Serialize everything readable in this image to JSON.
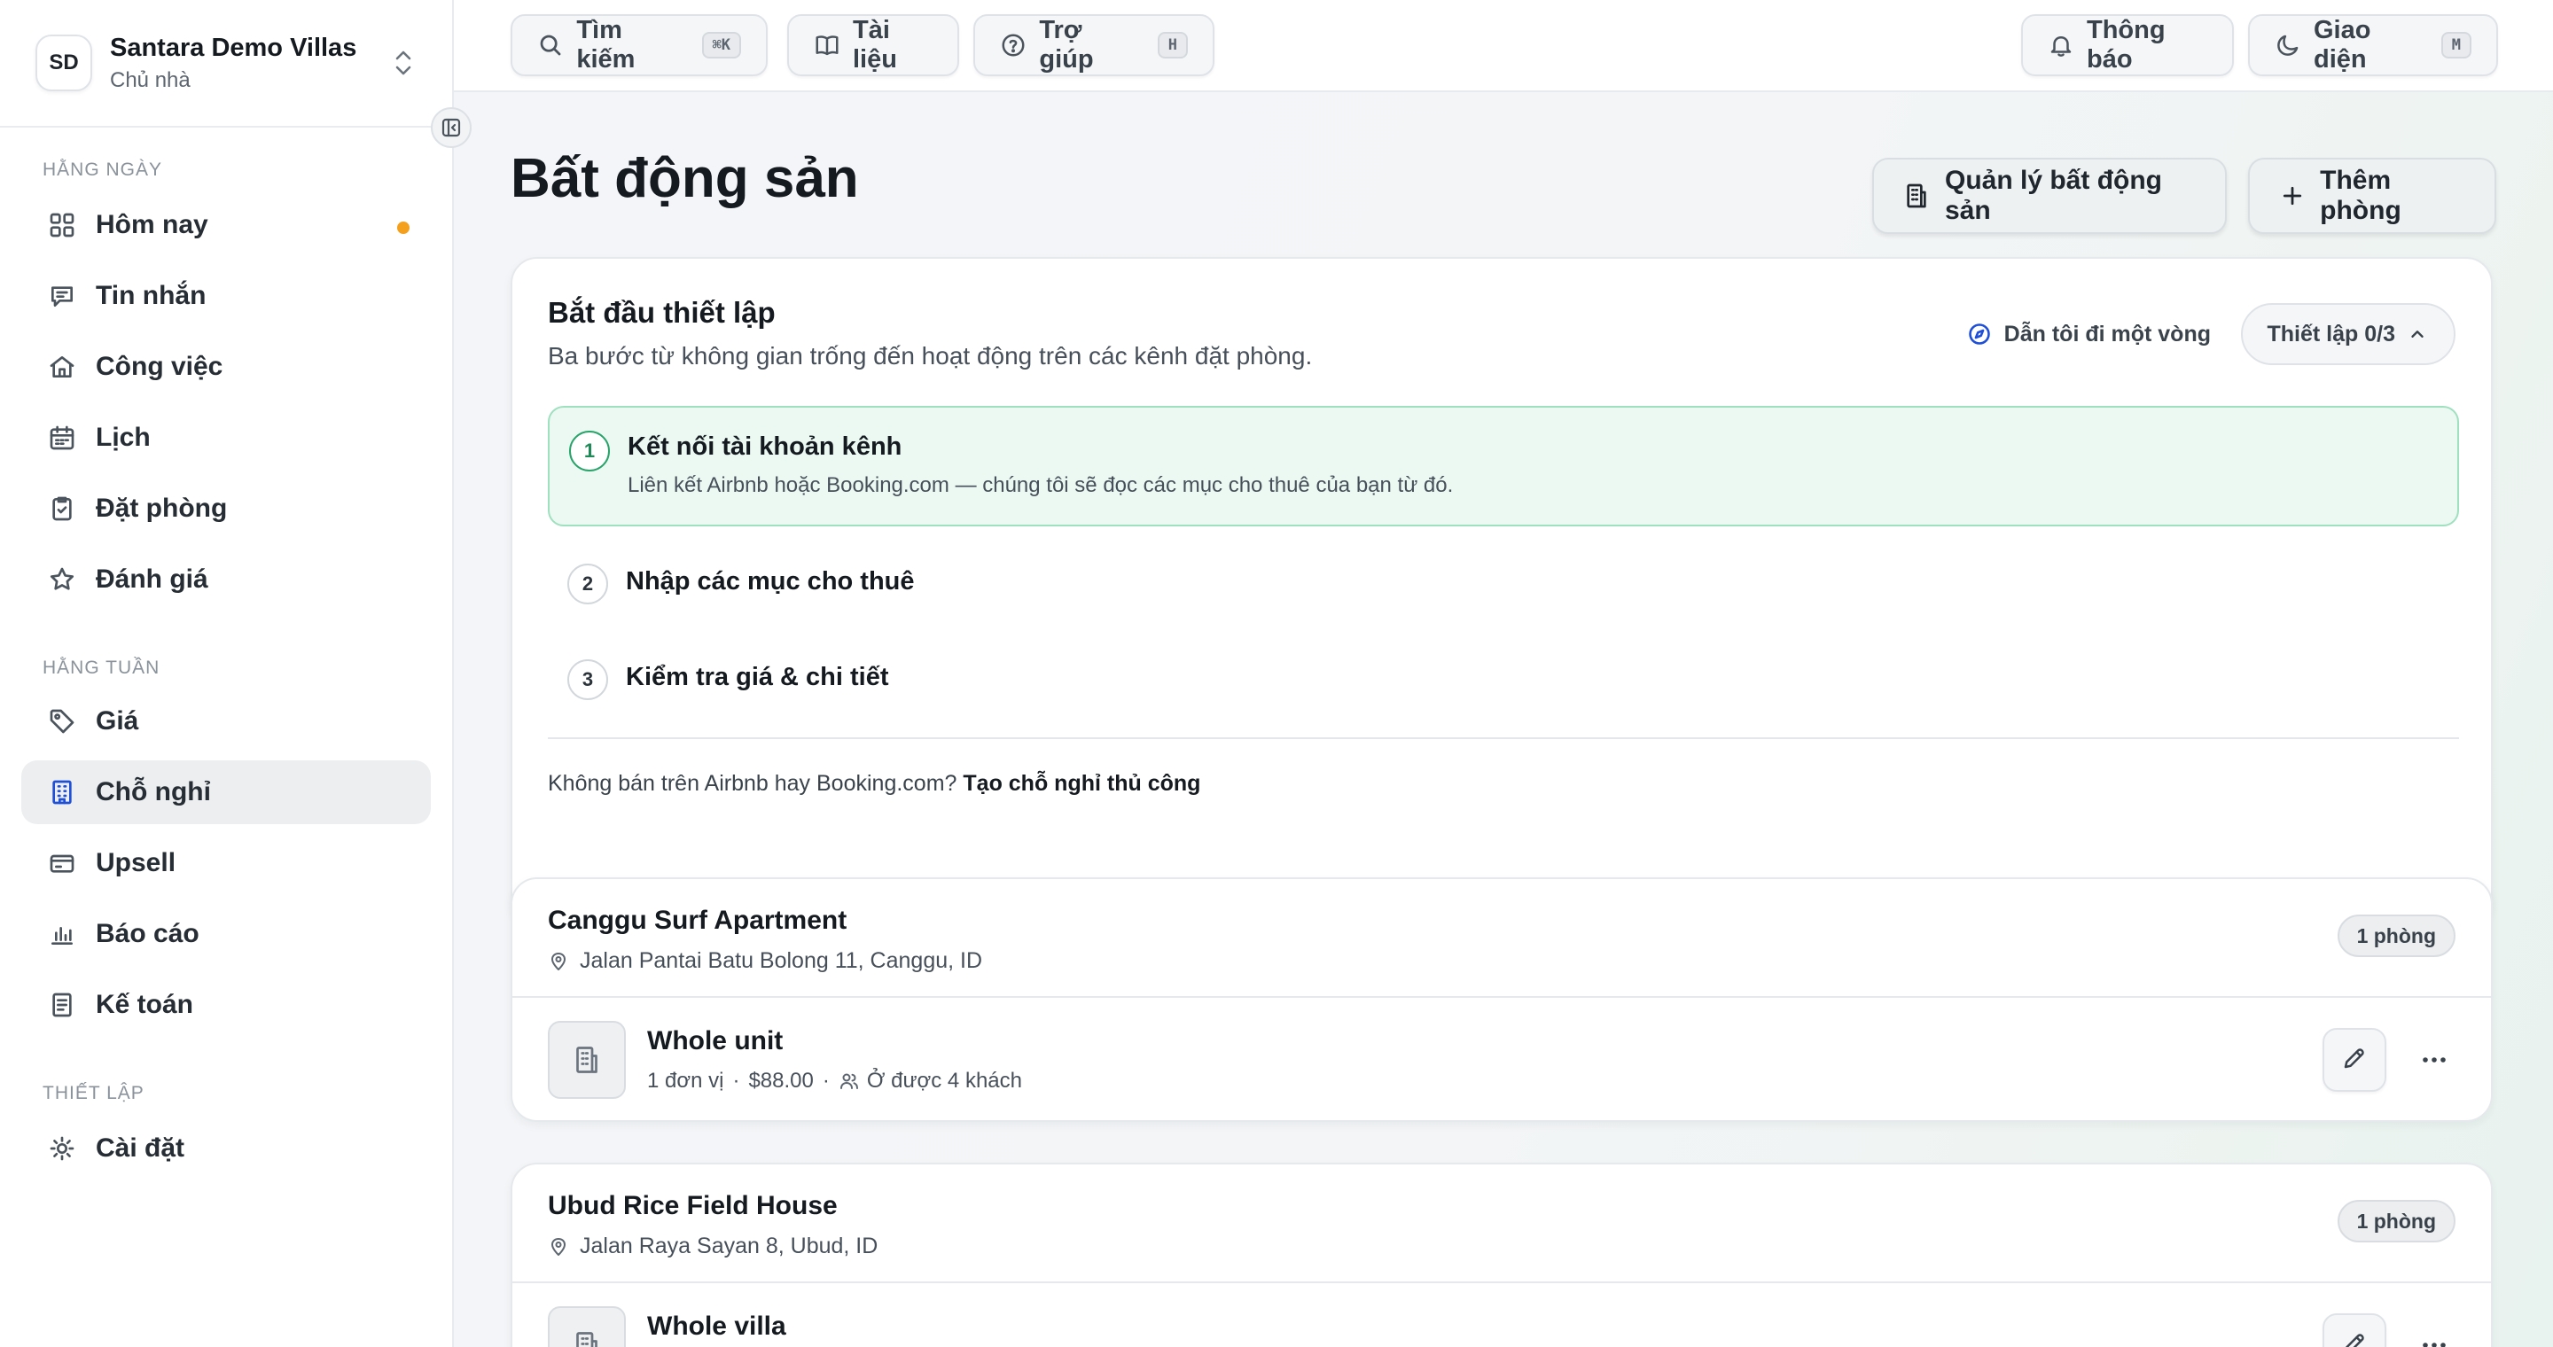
{
  "org": {
    "initials": "SD",
    "name": "Santara Demo Villas",
    "role": "Chủ nhà"
  },
  "sidebar": {
    "sections": [
      {
        "label": "HẰNG NGÀY"
      },
      {
        "label": "HẰNG TUẦN"
      },
      {
        "label": "THIẾT LẬP"
      }
    ],
    "items": [
      {
        "label": "Hôm nay",
        "icon": "dashboard-icon"
      },
      {
        "label": "Tin nhắn",
        "icon": "message-icon"
      },
      {
        "label": "Công việc",
        "icon": "home-icon"
      },
      {
        "label": "Lịch",
        "icon": "calendar-icon"
      },
      {
        "label": "Đặt phòng",
        "icon": "clipboard-check-icon"
      },
      {
        "label": "Đánh giá",
        "icon": "star-icon"
      },
      {
        "label": "Giá",
        "icon": "tag-icon"
      },
      {
        "label": "Chỗ nghỉ",
        "icon": "building-icon",
        "active": true
      },
      {
        "label": "Upsell",
        "icon": "card-icon"
      },
      {
        "label": "Báo cáo",
        "icon": "bar-chart-icon"
      },
      {
        "label": "Kế toán",
        "icon": "ledger-icon"
      },
      {
        "label": "Cài đặt",
        "icon": "sun-gear-icon"
      }
    ]
  },
  "topbar": {
    "search": {
      "label": "Tìm kiếm",
      "kbd": "⌘K"
    },
    "docs": {
      "label": "Tài liệu"
    },
    "help": {
      "label": "Trợ giúp",
      "kbd": "H"
    },
    "notifications": {
      "label": "Thông báo"
    },
    "theme": {
      "label": "Giao diện",
      "kbd": "M"
    }
  },
  "page": {
    "title": "Bất động sản",
    "manage_label": "Quản lý bất động sản",
    "add_room_label": "Thêm phòng"
  },
  "setup": {
    "title": "Bắt đầu thiết lập",
    "subtitle": "Ba bước từ không gian trống đến hoạt động trên các kênh đặt phòng.",
    "tour_label": "Dẫn tôi đi một vòng",
    "progress_label": "Thiết lập 0/3",
    "steps": [
      {
        "num": "1",
        "title": "Kết nối tài khoản kênh",
        "desc": "Liên kết Airbnb hoặc Booking.com — chúng tôi sẽ đọc các mục cho thuê của bạn từ đó."
      },
      {
        "num": "2",
        "title": "Nhập các mục cho thuê"
      },
      {
        "num": "3",
        "title": "Kiểm tra giá & chi tiết"
      }
    ],
    "footer_text": "Không bán trên Airbnb hay Booking.com?",
    "footer_link": "Tạo chỗ nghỉ thủ công"
  },
  "properties": [
    {
      "name": "Canggu Surf Apartment",
      "address": "Jalan Pantai Batu Bolong 11, Canggu, ID",
      "badge": "1 phòng",
      "unit": {
        "name": "Whole unit",
        "units": "1 đơn vị",
        "price": "$88.00",
        "capacity": "Ở được 4 khách"
      }
    },
    {
      "name": "Ubud Rice Field House",
      "address": "Jalan Raya Sayan 8, Ubud, ID",
      "badge": "1 phòng",
      "unit": {
        "name": "Whole villa"
      }
    }
  ],
  "colors": {
    "accent": "#1f4fd6",
    "active_step_bg": "#ebf9f2",
    "active_step_border": "#9fe0bf",
    "notification_dot": "#f4a01c"
  }
}
